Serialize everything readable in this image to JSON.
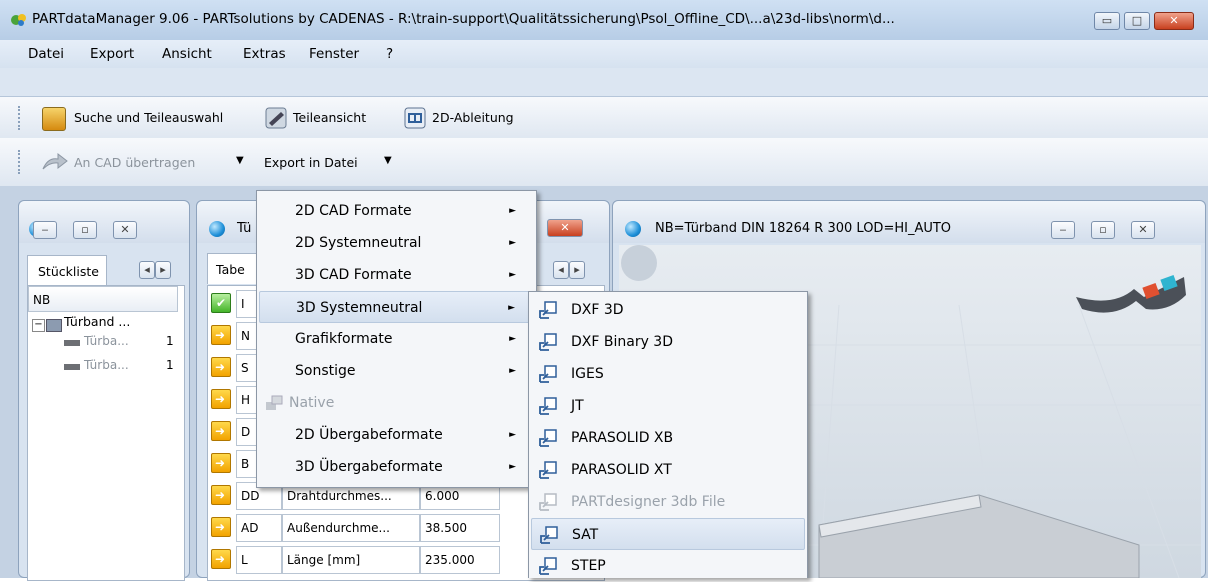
{
  "window": {
    "title": "PARTdataManager 9.06 - PARTsolutions by CADENAS - R:\\train-support\\Qualitätssicherung\\Psol_Offline_CD\\...a\\23d-libs\\norm\\d...",
    "minimize_glyph": "▭",
    "maximize_glyph": "□",
    "close_glyph": "✕"
  },
  "menubar": [
    "Datei",
    "Export",
    "Ansicht",
    "Extras",
    "Fenster",
    "?"
  ],
  "toolbar1": {
    "search_label": "Suche und Teileauswahl",
    "partview_label": "Teileansicht",
    "derive2d_label": "2D-Ableitung"
  },
  "toolbar2": {
    "transfer_label": "An CAD übertragen",
    "export_label": "Export in Datei",
    "dropdown_glyph": "▼"
  },
  "left_panel": {
    "tab_label": "Stückliste",
    "column_header": "NB",
    "tree": [
      {
        "label": "Türband ...",
        "value": ""
      },
      {
        "label": "Türba...",
        "value": "1"
      },
      {
        "label": "Türba...",
        "value": "1"
      }
    ]
  },
  "middle_panel": {
    "title_partial": "Tü",
    "tab_partial": "Tabe",
    "rows": [
      {
        "code": "I",
        "name": "",
        "value": ""
      },
      {
        "code": "N",
        "name": "",
        "value": ""
      },
      {
        "code": "S",
        "name": "",
        "value": ""
      },
      {
        "code": "H",
        "name": "",
        "value": ""
      },
      {
        "code": "D",
        "name": "",
        "value": ""
      },
      {
        "code": "B",
        "name": "",
        "value": ""
      },
      {
        "code": "DD",
        "name": "Drahtdurchmes...",
        "value": "6.000"
      },
      {
        "code": "AD",
        "name": "Außendurchme...",
        "value": "38.500"
      },
      {
        "code": "L",
        "name": "Länge [mm]",
        "value": "235.000"
      }
    ]
  },
  "right_panel": {
    "title": "NB=Türband DIN 18264 R 300 LOD=HI_AUTO"
  },
  "export_menu": [
    {
      "label": "2D CAD Formate",
      "submenu": true,
      "disabled": false
    },
    {
      "label": "2D Systemneutral",
      "submenu": true,
      "disabled": false
    },
    {
      "label": "3D CAD Formate",
      "submenu": true,
      "disabled": false
    },
    {
      "label": "3D Systemneutral",
      "submenu": true,
      "disabled": false,
      "highlighted": true
    },
    {
      "label": "Grafikformate",
      "submenu": true,
      "disabled": false
    },
    {
      "label": "Sonstige",
      "submenu": true,
      "disabled": false
    },
    {
      "label": "Native",
      "submenu": false,
      "disabled": true
    },
    {
      "label": "2D Übergabeformate",
      "submenu": true,
      "disabled": false
    },
    {
      "label": "3D Übergabeformate",
      "submenu": true,
      "disabled": false
    }
  ],
  "submenu_arrow": "►",
  "format_submenu": [
    {
      "label": "DXF 3D",
      "disabled": false
    },
    {
      "label": "DXF Binary 3D",
      "disabled": false
    },
    {
      "label": "IGES",
      "disabled": false
    },
    {
      "label": "JT",
      "disabled": false
    },
    {
      "label": "PARASOLID XB",
      "disabled": false
    },
    {
      "label": "PARASOLID XT",
      "disabled": false
    },
    {
      "label": "PARTdesigner 3db File",
      "disabled": true
    },
    {
      "label": "SAT",
      "disabled": false,
      "highlighted": true
    },
    {
      "label": "STEP",
      "disabled": false
    }
  ],
  "colors": {
    "accent": "#1d8fd8",
    "close_red": "#c8401f",
    "menu_bg": "#f4f6f9"
  }
}
